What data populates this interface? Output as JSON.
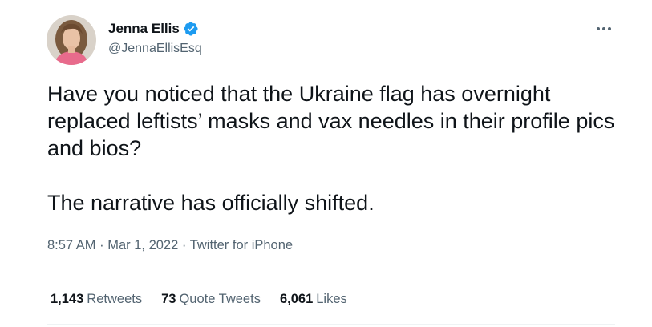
{
  "author": {
    "display_name": "Jenna Ellis",
    "handle": "@JennaEllisEsq",
    "verified": true,
    "avatar_icon": "profile-photo"
  },
  "tweet": {
    "paragraphs": [
      "Have you noticed that the Ukraine flag has overnight replaced leftists’ masks and vax needles in their profile pics and bios?",
      "The narrative has officially shifted."
    ]
  },
  "meta": {
    "time": "8:57 AM",
    "separator": "·",
    "date": "Mar 1, 2022",
    "source": "Twitter for iPhone"
  },
  "stats": {
    "retweets": {
      "count": "1,143",
      "label": "Retweets"
    },
    "quote_tweets": {
      "count": "73",
      "label": "Quote Tweets"
    },
    "likes": {
      "count": "6,061",
      "label": "Likes"
    }
  },
  "colors": {
    "verified_blue": "#1d9bf0",
    "text_primary": "#0f1419",
    "text_secondary": "#536471",
    "border": "#eff3f4"
  }
}
